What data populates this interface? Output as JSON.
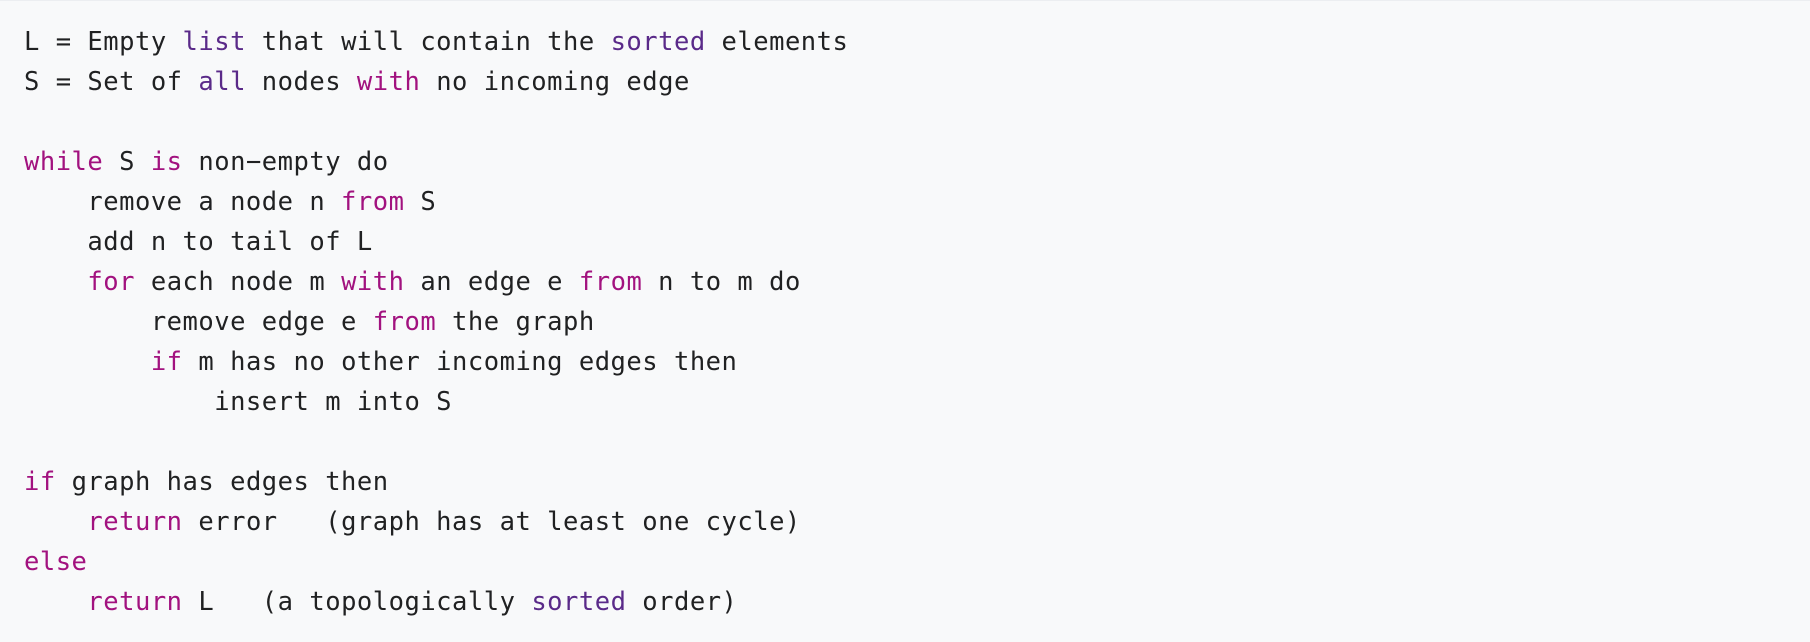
{
  "colors": {
    "background": "#f8f9fa",
    "text": "#202122",
    "keyword": "#a2127f",
    "builtin": "#5a2a89"
  },
  "code": {
    "lines": [
      [
        {
          "t": "L = Empty ",
          "k": "plain"
        },
        {
          "t": "list",
          "k": "builtin"
        },
        {
          "t": " that will contain the ",
          "k": "plain"
        },
        {
          "t": "sorted",
          "k": "builtin"
        },
        {
          "t": " elements",
          "k": "plain"
        }
      ],
      [
        {
          "t": "S = Set of ",
          "k": "plain"
        },
        {
          "t": "all",
          "k": "builtin"
        },
        {
          "t": " nodes ",
          "k": "plain"
        },
        {
          "t": "with",
          "k": "keyword"
        },
        {
          "t": " no incoming edge",
          "k": "plain"
        }
      ],
      [],
      [
        {
          "t": "while",
          "k": "keyword"
        },
        {
          "t": " S ",
          "k": "plain"
        },
        {
          "t": "is",
          "k": "keyword"
        },
        {
          "t": " non−empty do",
          "k": "plain"
        }
      ],
      [
        {
          "t": "    remove a node n ",
          "k": "plain"
        },
        {
          "t": "from",
          "k": "keyword"
        },
        {
          "t": " S",
          "k": "plain"
        }
      ],
      [
        {
          "t": "    add n to tail of L",
          "k": "plain"
        }
      ],
      [
        {
          "t": "    ",
          "k": "plain"
        },
        {
          "t": "for",
          "k": "keyword"
        },
        {
          "t": " each node m ",
          "k": "plain"
        },
        {
          "t": "with",
          "k": "keyword"
        },
        {
          "t": " an edge e ",
          "k": "plain"
        },
        {
          "t": "from",
          "k": "keyword"
        },
        {
          "t": " n to m do",
          "k": "plain"
        }
      ],
      [
        {
          "t": "        remove edge e ",
          "k": "plain"
        },
        {
          "t": "from",
          "k": "keyword"
        },
        {
          "t": " the graph",
          "k": "plain"
        }
      ],
      [
        {
          "t": "        ",
          "k": "plain"
        },
        {
          "t": "if",
          "k": "keyword"
        },
        {
          "t": " m has no other incoming edges then",
          "k": "plain"
        }
      ],
      [
        {
          "t": "            insert m into S",
          "k": "plain"
        }
      ],
      [],
      [
        {
          "t": "if",
          "k": "keyword"
        },
        {
          "t": " graph has edges then",
          "k": "plain"
        }
      ],
      [
        {
          "t": "    ",
          "k": "plain"
        },
        {
          "t": "return",
          "k": "keyword"
        },
        {
          "t": " error   (graph has at least one cycle)",
          "k": "plain"
        }
      ],
      [
        {
          "t": "else",
          "k": "keyword"
        }
      ],
      [
        {
          "t": "    ",
          "k": "plain"
        },
        {
          "t": "return",
          "k": "keyword"
        },
        {
          "t": " L   (a topologically ",
          "k": "plain"
        },
        {
          "t": "sorted",
          "k": "builtin"
        },
        {
          "t": " order)",
          "k": "plain"
        }
      ]
    ]
  }
}
